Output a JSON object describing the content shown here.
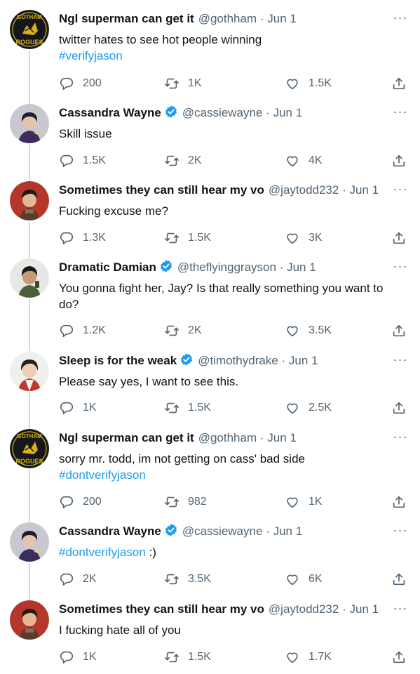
{
  "tweets": [
    {
      "name": "Ngl superman can get it",
      "verified": false,
      "handle": "@gothham",
      "date": "Jun 1",
      "lines": [
        [
          "twitter hates to see hot people winning"
        ],
        [
          "#verifyjason"
        ]
      ],
      "replies": "200",
      "retweets": "1K",
      "likes": "1.5K",
      "avatar": "gotham-rogues-logo"
    },
    {
      "name": "Cassandra Wayne",
      "verified": true,
      "handle": "@cassiewayne",
      "date": "Jun 1",
      "text": "Skill issue",
      "replies": "1.5K",
      "retweets": "2K",
      "likes": "4K",
      "avatar": "cassandra-avatar"
    },
    {
      "name": "Sometimes they can still hear my vo",
      "verified": false,
      "handle": "@jaytodd232",
      "date": "Jun 1",
      "text": "Fucking excuse me?",
      "replies": "1.3K",
      "retweets": "1.5K",
      "likes": "3K",
      "avatar": "jason-avatar"
    },
    {
      "name": "Dramatic Damian",
      "verified": true,
      "handle": "@theflyinggrayson",
      "date": "Jun 1",
      "line1": "You gonna fight her, Jay? Is that really something you want to",
      "line2": "do?",
      "replies": "1.2K",
      "retweets": "2K",
      "likes": "3.5K",
      "avatar": "damian-avatar"
    },
    {
      "name": "Sleep is for the weak",
      "verified": true,
      "handle": "@timothydrake",
      "date": "Jun 1",
      "text": "Please say yes, I want to see this.",
      "replies": "1K",
      "retweets": "1.5K",
      "likes": "2.5K",
      "avatar": "tim-avatar"
    },
    {
      "name": "Ngl superman can get it",
      "verified": false,
      "handle": "@gothham",
      "date": "Jun 1",
      "line1": "sorry mr. todd, im not getting on cass' bad side",
      "tag": "#dontverifyjason",
      "replies": "200",
      "retweets": "982",
      "likes": "1K",
      "avatar": "gotham-rogues-logo"
    },
    {
      "name": "Cassandra Wayne",
      "verified": true,
      "handle": "@cassiewayne",
      "date": "Jun 1",
      "tag": "#dontverifyjason",
      "suffix": " :)",
      "replies": "2K",
      "retweets": "3.5K",
      "likes": "6K",
      "avatar": "cassandra-avatar"
    },
    {
      "name": "Sometimes they can still hear my vo",
      "verified": false,
      "handle": "@jaytodd232",
      "date": "Jun 1",
      "text": "I fucking hate all of you",
      "replies": "1K",
      "retweets": "1.5K",
      "likes": "1.7K",
      "avatar": "jason-avatar"
    }
  ],
  "logo": {
    "top": "GOTHAM",
    "bottom": "ROGUES"
  },
  "separator": "·",
  "more_glyph": "···",
  "colors": {
    "link": "#1d9bf0",
    "muted": "#536471",
    "line": "#cfd9de",
    "verified": "#1d9bf0"
  }
}
